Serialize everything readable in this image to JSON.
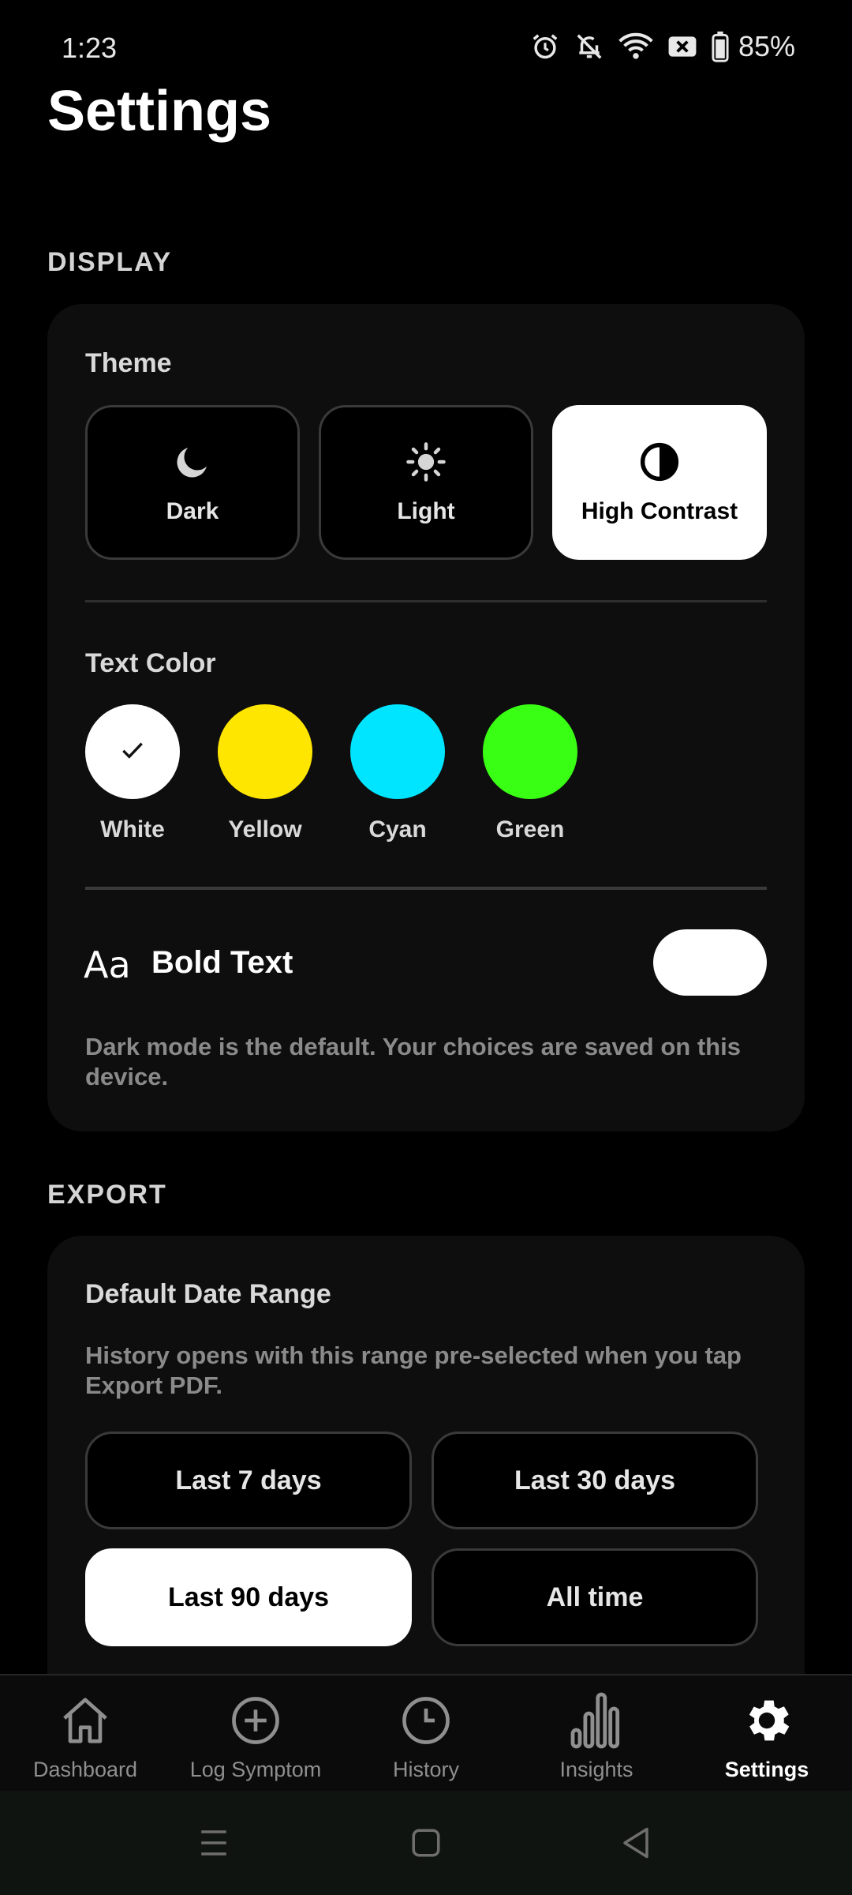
{
  "status_bar": {
    "time": "1:23",
    "battery": "85%"
  },
  "page": {
    "title": "Settings"
  },
  "display": {
    "section_label": "DISPLAY",
    "theme_label": "Theme",
    "theme_options": [
      {
        "label": "Dark",
        "icon": "moon-icon",
        "selected": false
      },
      {
        "label": "Light",
        "icon": "sun-icon",
        "selected": false
      },
      {
        "label": "High Contrast",
        "icon": "contrast-icon",
        "selected": true
      }
    ],
    "text_color_label": "Text Color",
    "text_colors": [
      {
        "label": "White",
        "color": "#ffffff",
        "selected": true
      },
      {
        "label": "Yellow",
        "color": "#ffe600",
        "selected": false
      },
      {
        "label": "Cyan",
        "color": "#00e5ff",
        "selected": false
      },
      {
        "label": "Green",
        "color": "#39ff14",
        "selected": false
      }
    ],
    "bold_text_icon": "Aa",
    "bold_text_label": "Bold Text",
    "bold_text_enabled": true,
    "help": "Dark mode is the default. Your choices are saved on this device."
  },
  "export": {
    "section_label": "EXPORT",
    "date_range_label": "Default Date Range",
    "help": "History opens with this range pre-selected when you tap Export PDF.",
    "ranges": [
      {
        "label": "Last 7 days",
        "selected": false
      },
      {
        "label": "Last 30 days",
        "selected": false
      },
      {
        "label": "Last 90 days",
        "selected": true
      },
      {
        "label": "All time",
        "selected": false
      }
    ]
  },
  "nav": {
    "items": [
      {
        "label": "Dashboard",
        "icon": "home-icon",
        "active": false
      },
      {
        "label": "Log Symptom",
        "icon": "plus-circle-icon",
        "active": false
      },
      {
        "label": "History",
        "icon": "clock-icon",
        "active": false
      },
      {
        "label": "Insights",
        "icon": "bar-chart-icon",
        "active": false
      },
      {
        "label": "Settings",
        "icon": "gear-icon",
        "active": true
      }
    ]
  }
}
